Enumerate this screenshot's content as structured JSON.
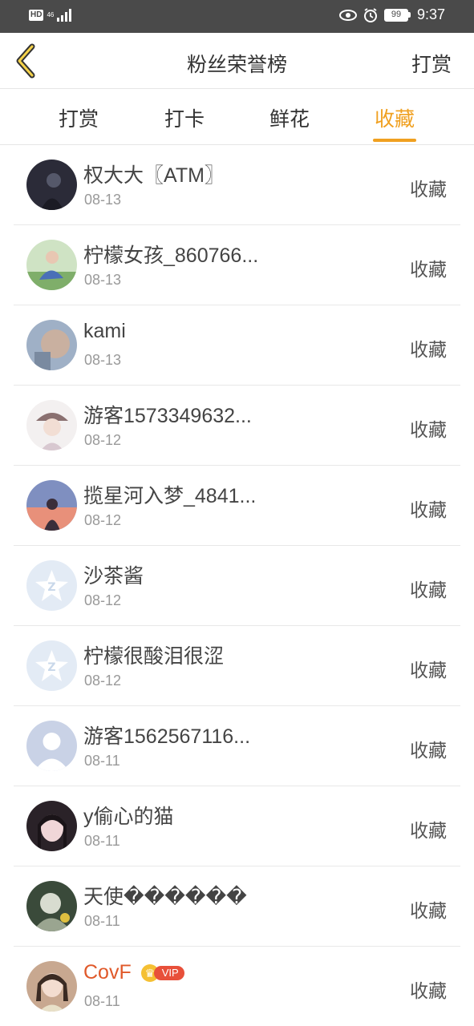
{
  "status_bar": {
    "hd": "HD",
    "network": "46",
    "battery": "99",
    "time": "9:37"
  },
  "header": {
    "title": "粉丝荣誉榜",
    "right_action": "打赏"
  },
  "tabs": [
    {
      "label": "打赏"
    },
    {
      "label": "打卡"
    },
    {
      "label": "鲜花"
    },
    {
      "label": "收藏",
      "active": true
    }
  ],
  "accent_color": "#f0a020",
  "fans": [
    {
      "name": "权大大〖ATM〗",
      "date": "08-13",
      "action": "收藏"
    },
    {
      "name": "柠檬女孩_860766...",
      "date": "08-13",
      "action": "收藏"
    },
    {
      "name": "kami",
      "date": "08-13",
      "action": "收藏"
    },
    {
      "name": "游客1573349632...",
      "date": "08-12",
      "action": "收藏"
    },
    {
      "name": "揽星河入梦_4841...",
      "date": "08-12",
      "action": "收藏"
    },
    {
      "name": "沙茶酱",
      "date": "08-12",
      "action": "收藏"
    },
    {
      "name": "柠檬很酸泪很涩",
      "date": "08-12",
      "action": "收藏"
    },
    {
      "name": "游客1562567116...",
      "date": "08-11",
      "action": "收藏"
    },
    {
      "name": "y偷心的猫",
      "date": "08-11",
      "action": "收藏"
    },
    {
      "name": "天使������",
      "date": "08-11",
      "action": "收藏"
    },
    {
      "name": "CovF",
      "date": "08-11",
      "action": "收藏",
      "badge": "VIP"
    }
  ]
}
